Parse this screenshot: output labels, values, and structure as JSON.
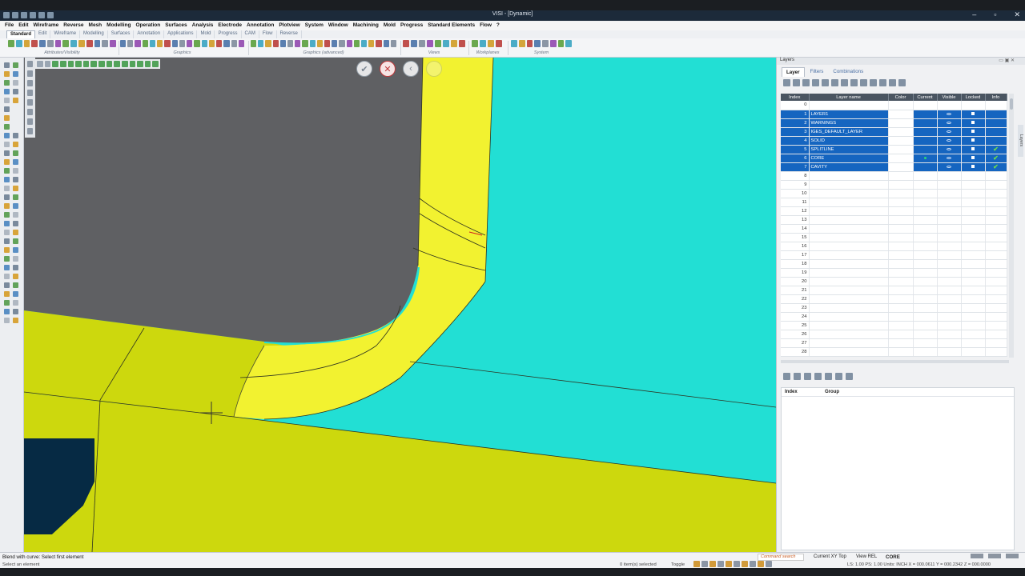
{
  "app": {
    "title": "VISI - [Dynamic]"
  },
  "menu": [
    "File",
    "Edit",
    "Wireframe",
    "Reverse",
    "Mesh",
    "Modelling",
    "Operation",
    "Surfaces",
    "Analysis",
    "Electrode",
    "Annotation",
    "Plotview",
    "System",
    "Window",
    "Machining",
    "Mold",
    "Progress",
    "Standard Elements",
    "Flow",
    "?"
  ],
  "tabs": [
    "Standard",
    "Edit",
    "Wireframe",
    "Modelling",
    "Surfaces",
    "Annotation",
    "Applications",
    "Mold",
    "Progress",
    "CAM",
    "Flow",
    "Reverse"
  ],
  "ribbon_groups": [
    "Attributes/Visibility",
    "Graphics",
    "Graphics (advanced)",
    "Views",
    "Workplanes",
    "System"
  ],
  "panel": {
    "title": "Layers",
    "tabs": [
      "Layer",
      "Filters",
      "Combinations"
    ],
    "columns": [
      "Index",
      "Layer name",
      "Color",
      "Current",
      "Visible",
      "Locked",
      "Info"
    ],
    "rows": [
      {
        "index": "0",
        "name": "",
        "selected": false,
        "info": false
      },
      {
        "index": "1",
        "name": "LAYER1",
        "selected": true,
        "info": false
      },
      {
        "index": "2",
        "name": "WARNINGS",
        "selected": true,
        "info": false
      },
      {
        "index": "3",
        "name": "IGES_DEFAULT_LAYER",
        "selected": true,
        "info": false
      },
      {
        "index": "4",
        "name": "SOLID",
        "selected": true,
        "info": false
      },
      {
        "index": "5",
        "name": "SPLITLINE",
        "selected": true,
        "info": true
      },
      {
        "index": "6",
        "name": "CORE",
        "selected": true,
        "info": true,
        "current": true
      },
      {
        "index": "7",
        "name": "CAVITY",
        "selected": true,
        "info": true
      },
      {
        "index": "8",
        "name": ""
      },
      {
        "index": "9",
        "name": ""
      },
      {
        "index": "10",
        "name": ""
      },
      {
        "index": "11",
        "name": ""
      },
      {
        "index": "12",
        "name": ""
      },
      {
        "index": "13",
        "name": ""
      },
      {
        "index": "14",
        "name": ""
      },
      {
        "index": "15",
        "name": ""
      },
      {
        "index": "16",
        "name": ""
      },
      {
        "index": "17",
        "name": ""
      },
      {
        "index": "18",
        "name": ""
      },
      {
        "index": "19",
        "name": ""
      },
      {
        "index": "20",
        "name": ""
      },
      {
        "index": "21",
        "name": ""
      },
      {
        "index": "22",
        "name": ""
      },
      {
        "index": "23",
        "name": ""
      },
      {
        "index": "24",
        "name": ""
      },
      {
        "index": "25",
        "name": ""
      },
      {
        "index": "26",
        "name": ""
      },
      {
        "index": "27",
        "name": ""
      },
      {
        "index": "28",
        "name": ""
      }
    ],
    "group_columns": [
      "Index",
      "Group"
    ]
  },
  "status": {
    "prompt": "Blend with curve: Select first element",
    "hint": "Select an element",
    "command_search": "Command search",
    "workplane": "Current XY Top",
    "view": "View REL",
    "current_layer": "CORE",
    "selected": "0 item(s) selected",
    "toggle": "Toggle",
    "coords": "LS: 1.00 PS: 1.00   Units: INCH   X = 000.0611 Y = 000.2342 Z = 000.0000"
  },
  "colors": {
    "part_yellow": "#cdd80d",
    "core_cyan": "#22dfd4",
    "highlight_yellow": "#f2f230",
    "void_gray": "#5f6063",
    "selection_blue": "#1565c0"
  }
}
